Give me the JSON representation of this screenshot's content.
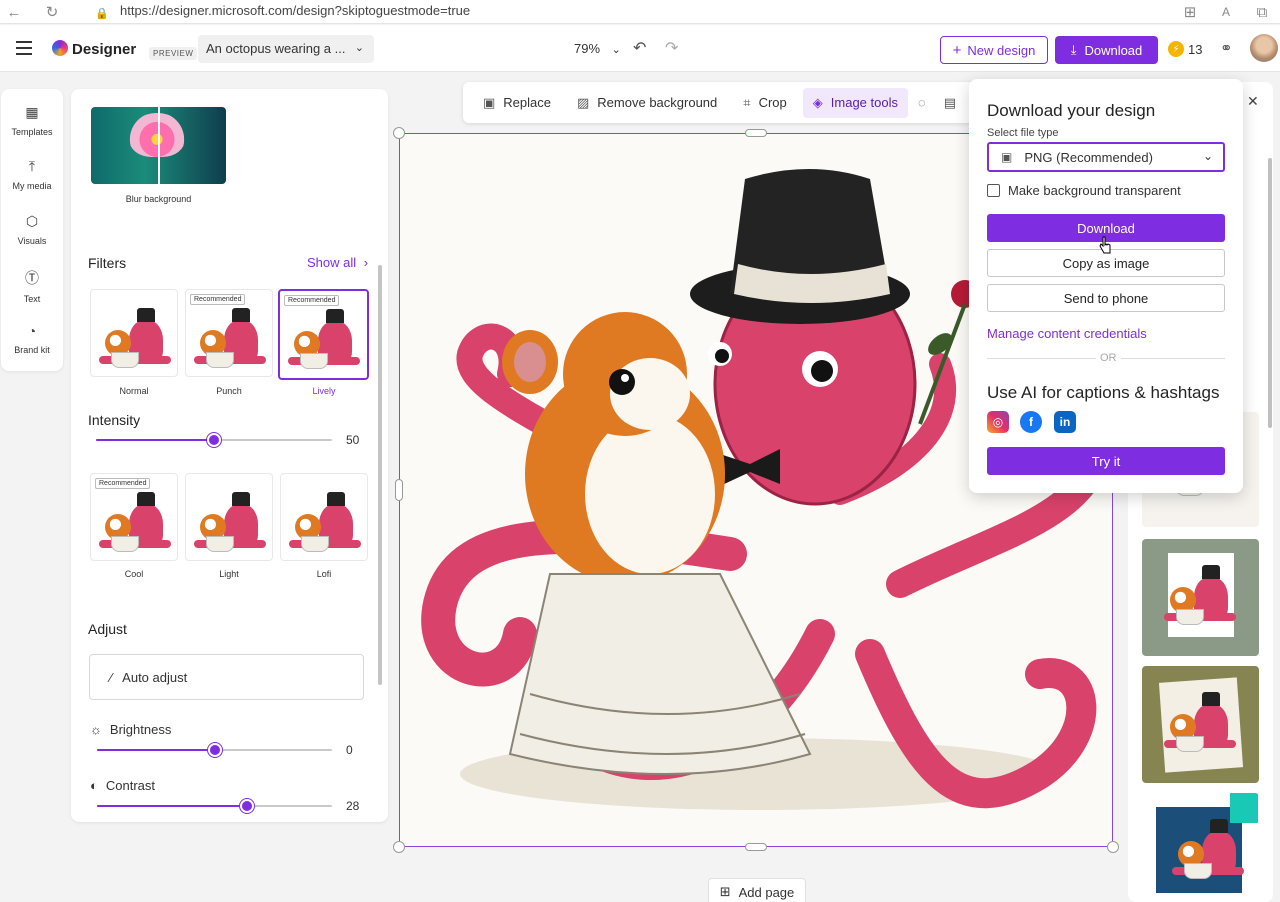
{
  "browser": {
    "url": "https://designer.microsoft.com/design?skiptoguestmode=true"
  },
  "header": {
    "brand": "Designer",
    "preview_badge": "PREVIEW",
    "design_title": "An octopus wearing a ...",
    "zoom": "79%",
    "new_design_label": "New design",
    "download_label": "Download",
    "credits": "13"
  },
  "left_rail": {
    "items": [
      {
        "label": "Templates",
        "icon": "templates-icon"
      },
      {
        "label": "My media",
        "icon": "upload-icon"
      },
      {
        "label": "Visuals",
        "icon": "visuals-icon"
      },
      {
        "label": "Text",
        "icon": "text-icon"
      },
      {
        "label": "Brand kit",
        "icon": "brand-kit-icon"
      }
    ]
  },
  "panel": {
    "blur_label": "Blur background",
    "filters_title": "Filters",
    "show_all": "Show all",
    "recommended_tag": "Recommended",
    "filters_row1": [
      {
        "label": "Normal",
        "recommended": false,
        "selected": false
      },
      {
        "label": "Punch",
        "recommended": true,
        "selected": false
      },
      {
        "label": "Lively",
        "recommended": true,
        "selected": true
      }
    ],
    "intensity_label": "Intensity",
    "intensity_value": "50",
    "intensity_fraction": 0.5,
    "filters_row2": [
      {
        "label": "Cool",
        "recommended": true
      },
      {
        "label": "Light",
        "recommended": false
      },
      {
        "label": "Lofi",
        "recommended": false
      }
    ],
    "adjust_title": "Adjust",
    "auto_adjust": "Auto adjust",
    "brightness_label": "Brightness",
    "brightness_value": "0",
    "brightness_fraction": 0.5,
    "contrast_label": "Contrast",
    "contrast_value": "28",
    "contrast_fraction": 0.64
  },
  "toolbar": {
    "replace": "Replace",
    "remove_background": "Remove background",
    "crop": "Crop",
    "image_tools": "Image tools"
  },
  "canvas": {
    "add_page": "Add page"
  },
  "download_popover": {
    "title": "Download your design",
    "file_type_label": "Select file type",
    "file_type_value": "PNG (Recommended)",
    "transparent_label": "Make background transparent",
    "transparent_checked": false,
    "download_btn": "Download",
    "copy_btn": "Copy as image",
    "phone_btn": "Send to phone",
    "manage_link": "Manage content credentials",
    "or_text": "OR",
    "ai_title": "Use AI for captions & hashtags",
    "try_btn": "Try it",
    "socials": [
      "instagram-icon",
      "facebook-icon",
      "linkedin-icon"
    ]
  },
  "colors": {
    "accent": "#7e2ee0",
    "octopus": "#d9426b",
    "hamster": "#e07a22"
  }
}
